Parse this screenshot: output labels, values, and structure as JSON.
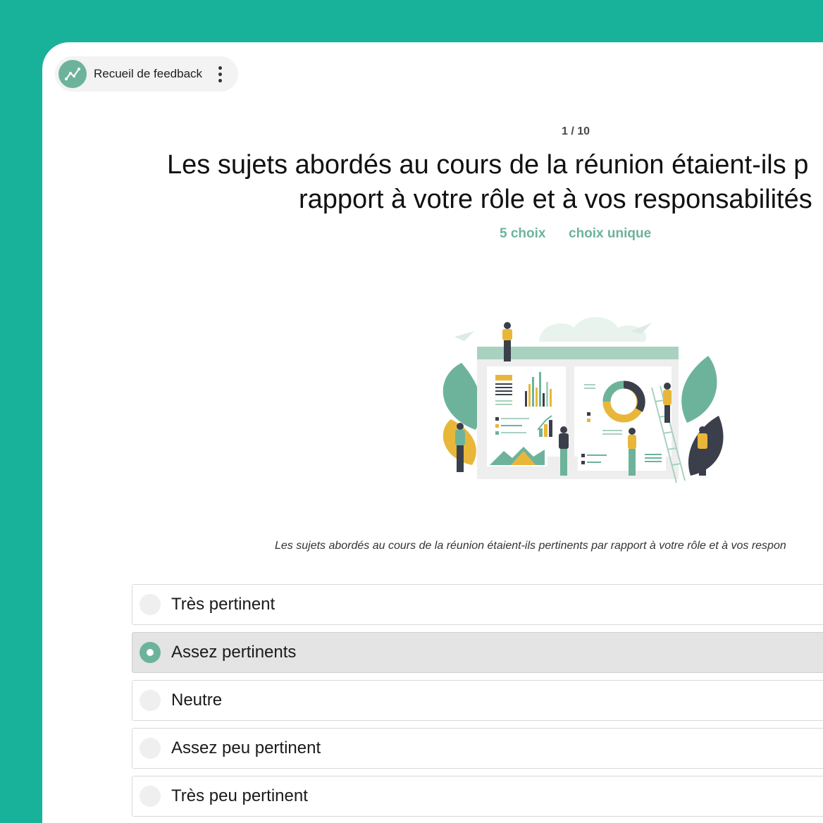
{
  "app": {
    "title": "Recueil de feedback",
    "logo_icon": "trend-line-icon",
    "menu_icon": "kebab-menu-icon"
  },
  "colors": {
    "background": "#18B29B",
    "accent": "#6DB39B",
    "selected_row": "#E4E4E4"
  },
  "question": {
    "counter": "1 / 10",
    "text_line1": "Les sujets abordés au cours de la réunion étaient-ils p",
    "text_line2": "rapport à votre rôle et à vos responsabilités",
    "choice_count": "5 choix",
    "choice_type": "choix unique",
    "caption": "Les sujets abordés au cours de la réunion étaient-ils pertinents par rapport à votre rôle et à vos respon"
  },
  "options": [
    {
      "label": "Très pertinent",
      "selected": false
    },
    {
      "label": "Assez pertinents",
      "selected": true
    },
    {
      "label": "Neutre",
      "selected": false
    },
    {
      "label": "Assez peu pertinent",
      "selected": false
    },
    {
      "label": "Très peu pertinent",
      "selected": false
    }
  ]
}
